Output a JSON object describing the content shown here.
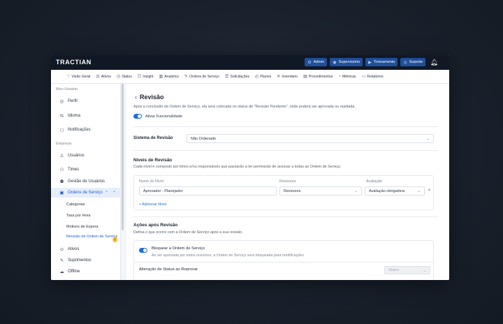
{
  "brand": "TRACTIAN",
  "topbar": {
    "buttons": [
      {
        "label": "Admin",
        "icon": "admin-icon"
      },
      {
        "label": "Supervisório",
        "icon": "supervisor-icon"
      },
      {
        "label": "Treinamento",
        "icon": "training-icon"
      },
      {
        "label": "Suporte",
        "icon": "support-icon"
      }
    ],
    "bell_icon": "bell-icon"
  },
  "menu": [
    {
      "label": "Visão Geral",
      "icon": "overview-icon"
    },
    {
      "label": "Ativos",
      "icon": "assets-icon"
    },
    {
      "label": "Status",
      "icon": "status-icon"
    },
    {
      "label": "Insight",
      "icon": "insight-icon"
    },
    {
      "label": "Analytics",
      "icon": "analytics-icon"
    },
    {
      "label": "Ordens de Serviço",
      "icon": "work-order-icon"
    },
    {
      "label": "Solicitações",
      "icon": "requests-icon"
    },
    {
      "label": "Planos",
      "icon": "plans-icon"
    },
    {
      "label": "Inventário",
      "icon": "inventory-icon"
    },
    {
      "label": "Procedimentos",
      "icon": "procedures-icon"
    },
    {
      "label": "Métricas",
      "icon": "metrics-icon"
    },
    {
      "label": "Relatórios",
      "icon": "reports-icon"
    }
  ],
  "sidebar": {
    "section_user": "Meu Usuário",
    "user_items": [
      {
        "label": "Perfil",
        "icon": "profile-icon"
      },
      {
        "label": "Idioma",
        "icon": "language-icon"
      },
      {
        "label": "Notificações",
        "icon": "notifications-icon"
      }
    ],
    "section_company": "Empresa",
    "company_items": [
      {
        "label": "Usuários",
        "icon": "users-icon"
      },
      {
        "label": "Times",
        "icon": "teams-icon"
      },
      {
        "label": "Gestão de Usuários",
        "icon": "user-management-icon"
      },
      {
        "label": "Ordens de Serviço",
        "icon": "work-order-icon",
        "badge": "*"
      }
    ],
    "sub_items": [
      "Categorias",
      "Taxa por Hora",
      "Motivos de Espera",
      "Revisão de Ordem de Serviço"
    ],
    "bottom_items": [
      {
        "label": "Ativos",
        "icon": "assets-icon"
      },
      {
        "label": "Suprimentos",
        "icon": "supplies-icon"
      },
      {
        "label": "Offline",
        "icon": "offline-icon"
      }
    ]
  },
  "content": {
    "title": "Revisão",
    "description": "Após a conclusão da Ordem de Serviço, ela será colocada no status de \"Revisão Pendente\", onde poderá ser aprovada ou rejeitada.",
    "activate_label": "Ativar Funcionalidade",
    "activate_on": true,
    "system_label": "Sistema de Revisão",
    "system_value": "Não Ordenado",
    "levels_title": "Níveis de Revisão",
    "levels_desc": "Cada nível é composto por times e/ou responsáveis que passarão a ter permissão de acessar a todas as Ordem de Serviço.",
    "columns": [
      "Nome do Nível",
      "Revisores",
      "Avaliação"
    ],
    "level_row": {
      "name": "Aprovador - Planejador",
      "reviewers": "Revisores",
      "evaluation": "Avaliação obrigatória"
    },
    "add_level": "+ Adicionar Nível",
    "actions_title": "Ações após Revisão",
    "actions_desc": "Defina o que ocorre com a Ordem de Serviço após a sua revisão.",
    "block_title": "Bloquear a Ordem de Serviço",
    "block_desc": "Ao ser aprovada por todos revisores, a Ordem de Serviço será bloqueada para modificações.",
    "block_on": true,
    "status_change_label": "Alteração de Status ao Reprovar",
    "status_placeholder": "Status"
  }
}
